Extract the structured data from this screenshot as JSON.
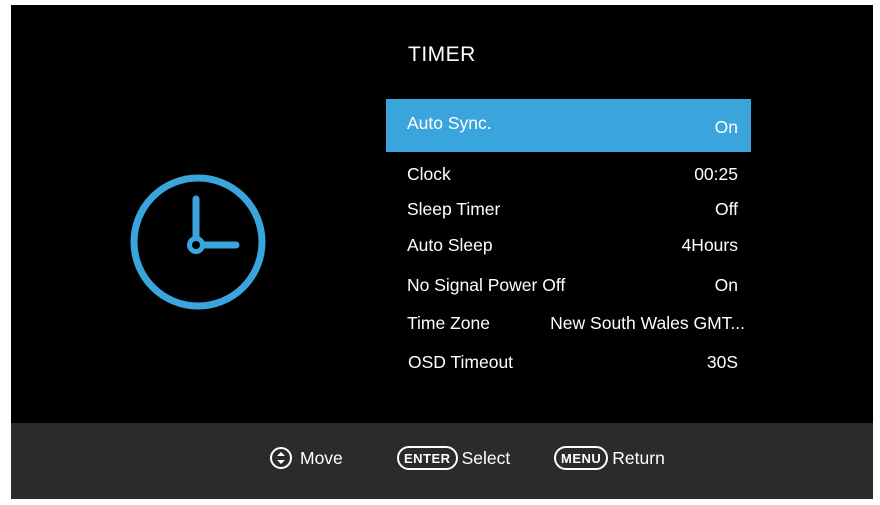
{
  "menu": {
    "title": "TIMER",
    "items": [
      {
        "label": "Auto Sync.",
        "value": "On",
        "selected": true
      },
      {
        "label": "Clock",
        "value": "00:25"
      },
      {
        "label": "Sleep Timer",
        "value": "Off"
      },
      {
        "label": "Auto Sleep",
        "value": "4Hours"
      },
      {
        "label": "No Signal Power Off",
        "value": "On"
      },
      {
        "label": "Time Zone",
        "value": "New South Wales GMT..."
      },
      {
        "label": "OSD Timeout",
        "value": "30S"
      }
    ]
  },
  "footer": {
    "move": {
      "label": "Move",
      "icon": "up-down-arrows-icon"
    },
    "select": {
      "key": "ENTER",
      "label": "Select"
    },
    "return": {
      "key": "MENU",
      "label": "Return"
    }
  },
  "icons": {
    "menu_icon": "clock-icon"
  },
  "colors": {
    "accent": "#3aa4dd",
    "background": "#000000",
    "footer_bg": "#2b2b2b",
    "text": "#ffffff"
  }
}
